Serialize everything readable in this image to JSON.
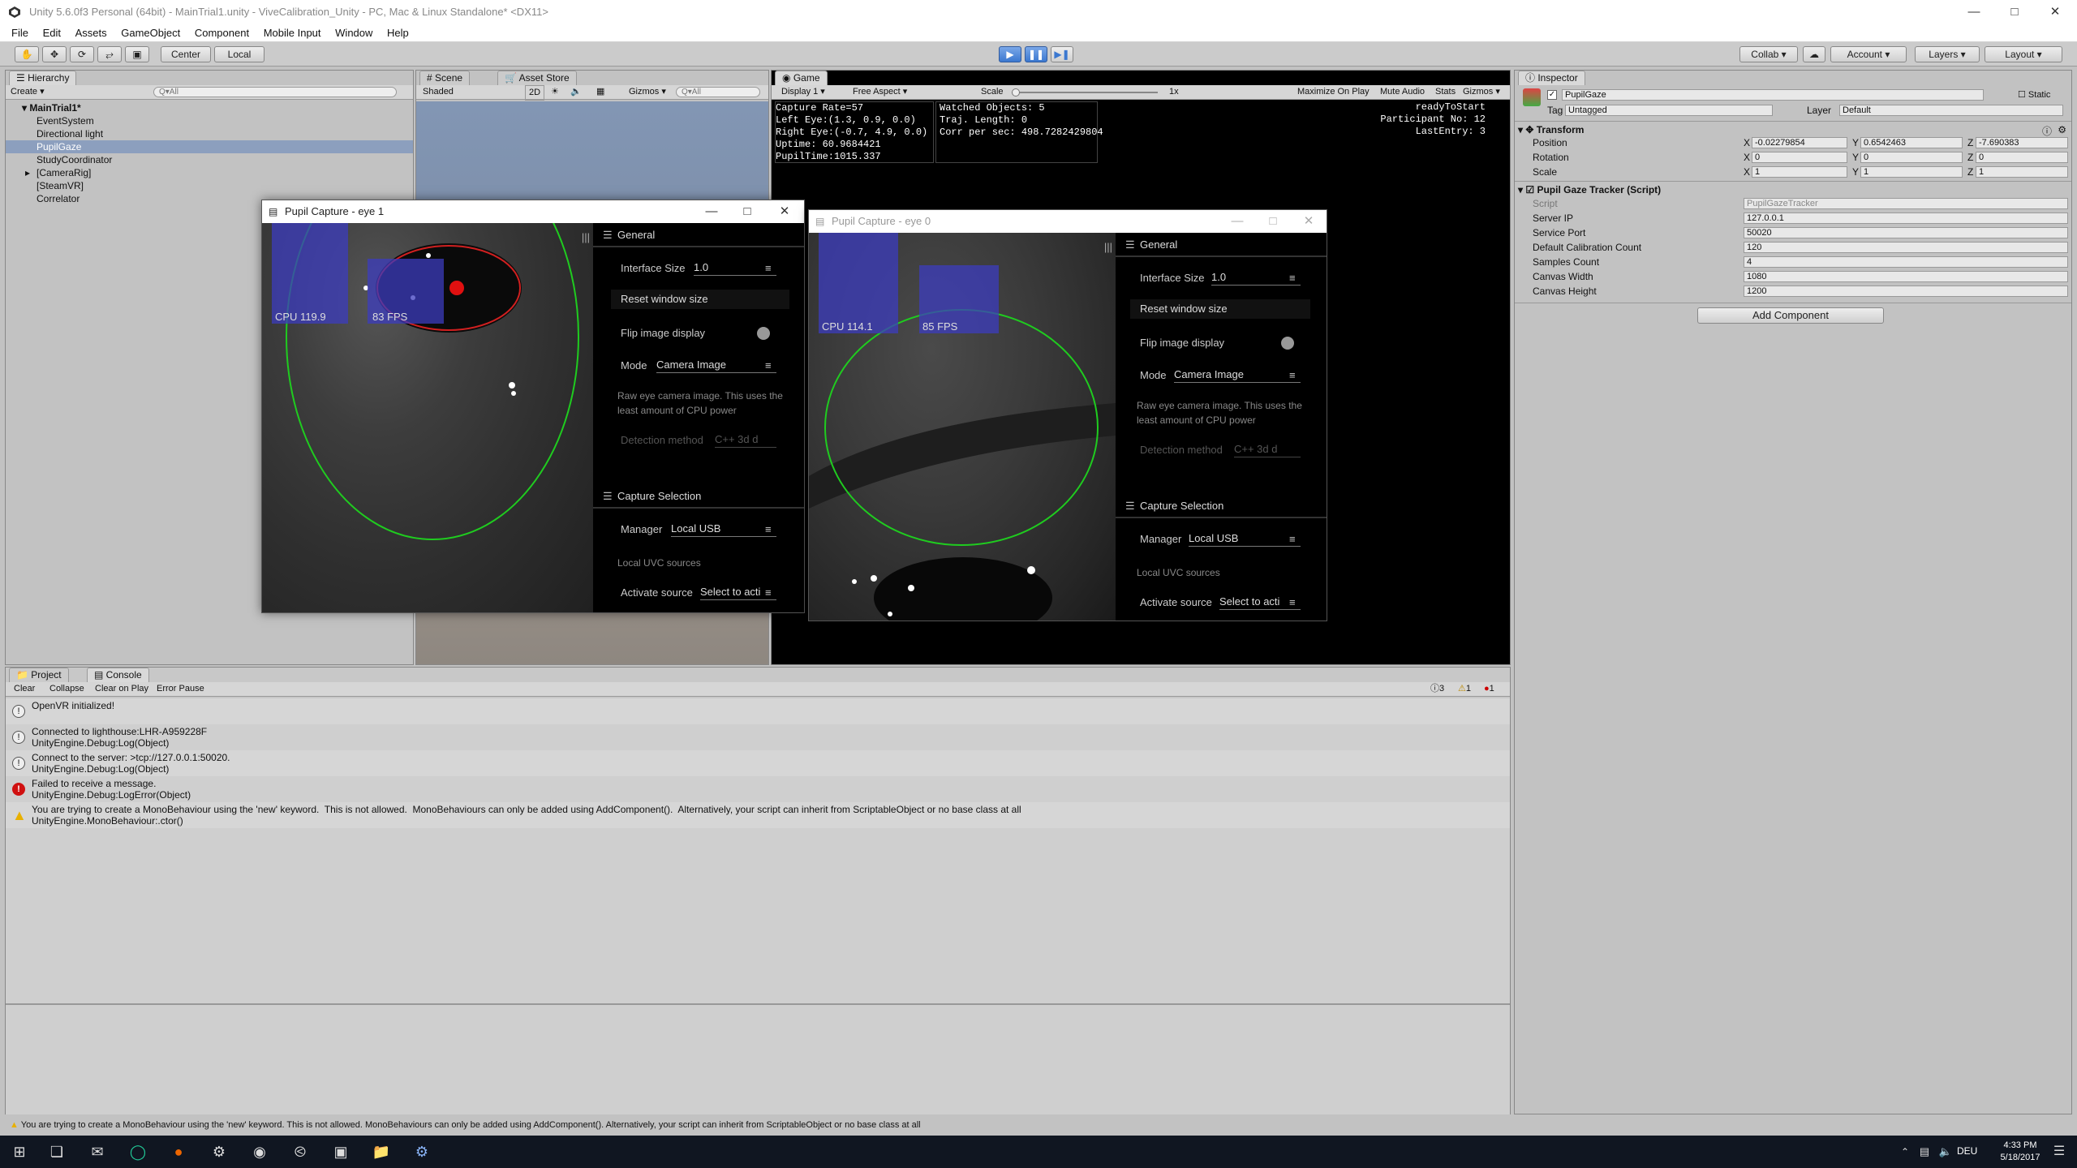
{
  "window": {
    "title": "Unity 5.6.0f3 Personal (64bit) - MainTrial1.unity - ViveCalibration_Unity - PC, Mac & Linux Standalone* <DX11>"
  },
  "menu": [
    "File",
    "Edit",
    "Assets",
    "GameObject",
    "Component",
    "Mobile Input",
    "Window",
    "Help"
  ],
  "toolbar": {
    "center": "Center",
    "local": "Local",
    "collab": "Collab",
    "account": "Account",
    "layers": "Layers",
    "layout": "Layout"
  },
  "hierarchy": {
    "tab": "Hierarchy",
    "create": "Create",
    "search": "Q▾All",
    "root": "MainTrial1*",
    "items": [
      "EventSystem",
      "Directional light",
      "PupilGaze",
      "StudyCoordinator",
      "[CameraRig]",
      "[SteamVR]",
      "Correlator"
    ]
  },
  "scene": {
    "tab": "Scene",
    "asset_tab": "Asset Store",
    "shading": "Shaded",
    "mode2d": "2D",
    "gizmos": "Gizmos",
    "search": "Q▾All"
  },
  "game": {
    "tab": "Game",
    "display": "Display 1",
    "aspect": "Free Aspect",
    "scale_label": "Scale",
    "scale_val": "1x",
    "maximize": "Maximize On Play",
    "mute": "Mute Audio",
    "stats": "Stats",
    "gizmos": "Gizmos",
    "stats1": "Capture Rate=57\nLeft Eye:(1.3, 0.9, 0.0)\nRight Eye:(-0.7, 4.9, 0.0)\nUptime: 60.9684421\nPupilTime:1015.337",
    "stats2": "Watched Objects: 5\nTraj. Length: 0\nCorr per sec: 498.7282429804",
    "stats3": "readyToStart\nParticipant No: 12\nLastEntry: 3"
  },
  "pupil1": {
    "title": "Pupil Capture - eye 1",
    "cpu": "CPU 119.9",
    "fps": "83 FPS",
    "general": "General",
    "iface_label": "Interface Size",
    "iface_val": "1.0",
    "reset": "Reset window size",
    "flip": "Flip image display",
    "mode_label": "Mode",
    "mode_val": "Camera Image",
    "desc": "Raw eye camera image. This uses the least amount of CPU power",
    "detect_label": "Detection method",
    "detect_val": "C++ 3d d",
    "capture": "Capture Selection",
    "manager_label": "Manager",
    "manager_val": "Local USB",
    "uvc": "Local UVC sources",
    "activate_label": "Activate source",
    "activate_val": "Select to acti"
  },
  "pupil0": {
    "title": "Pupil Capture - eye 0",
    "cpu": "CPU 114.1",
    "fps": "85 FPS",
    "general": "General",
    "iface_label": "Interface Size",
    "iface_val": "1.0",
    "reset": "Reset window size",
    "flip": "Flip image display",
    "mode_label": "Mode",
    "mode_val": "Camera Image",
    "desc": "Raw eye camera image. This uses the least amount of CPU power",
    "detect_label": "Detection method",
    "detect_val": "C++ 3d d",
    "capture": "Capture Selection",
    "manager_label": "Manager",
    "manager_val": "Local USB",
    "uvc": "Local UVC sources",
    "activate_label": "Activate source",
    "activate_val": "Select to acti"
  },
  "inspector": {
    "tab": "Inspector",
    "name": "PupilGaze",
    "static": "Static",
    "tag_label": "Tag",
    "tag_val": "Untagged",
    "layer_label": "Layer",
    "layer_val": "Default",
    "transform": "Transform",
    "pos_label": "Position",
    "pos": [
      "-0.02279854",
      "0.6542463",
      "-7.690383"
    ],
    "rot_label": "Rotation",
    "rot": [
      "0",
      "0",
      "0"
    ],
    "scale_label": "Scale",
    "scale": [
      "1",
      "1",
      "1"
    ],
    "script_title": "Pupil Gaze Tracker (Script)",
    "script_label": "Script",
    "script_val": "PupilGazeTracker",
    "fields": [
      {
        "label": "Server IP",
        "value": "127.0.0.1"
      },
      {
        "label": "Service Port",
        "value": "50020"
      },
      {
        "label": "Default Calibration Count",
        "value": "120"
      },
      {
        "label": "Samples Count",
        "value": "4"
      },
      {
        "label": "Canvas Width",
        "value": "1080"
      },
      {
        "label": "Canvas Height",
        "value": "1200"
      }
    ],
    "add_component": "Add Component"
  },
  "console": {
    "project_tab": "Project",
    "console_tab": "Console",
    "clear": "Clear",
    "collapse": "Collapse",
    "clear_on_play": "Clear on Play",
    "error_pause": "Error Pause",
    "count_info": "3",
    "count_warn": "1",
    "count_err": "1",
    "logs": [
      {
        "type": "info",
        "text": "OpenVR initialized!"
      },
      {
        "type": "info",
        "text": "Connected to lighthouse:LHR-A959228F\nUnityEngine.Debug:Log(Object)"
      },
      {
        "type": "info",
        "text": "Connect to the server: >tcp://127.0.0.1:50020.\nUnityEngine.Debug:Log(Object)"
      },
      {
        "type": "error",
        "text": "Failed to receive a message.\nUnityEngine.Debug:LogError(Object)"
      },
      {
        "type": "warn",
        "text": "You are trying to create a MonoBehaviour using the 'new' keyword.  This is not allowed.  MonoBehaviours can only be added using AddComponent().  Alternatively, your script can inherit from ScriptableObject or no base class at all\nUnityEngine.MonoBehaviour:.ctor()"
      }
    ],
    "status": "You are trying to create a MonoBehaviour using the 'new' keyword.  This is not allowed.  MonoBehaviours can only be added using AddComponent().  Alternatively, your script can inherit from ScriptableObject or no base class at all"
  },
  "taskbar": {
    "lang": "DEU",
    "time": "4:33 PM",
    "date": "5/18/2017"
  },
  "colors": {
    "accent": "#3b78d0",
    "selection": "#8c9fbe",
    "error": "#d01010",
    "warn": "#e8b000",
    "gaze_circle": "#22cc22"
  }
}
